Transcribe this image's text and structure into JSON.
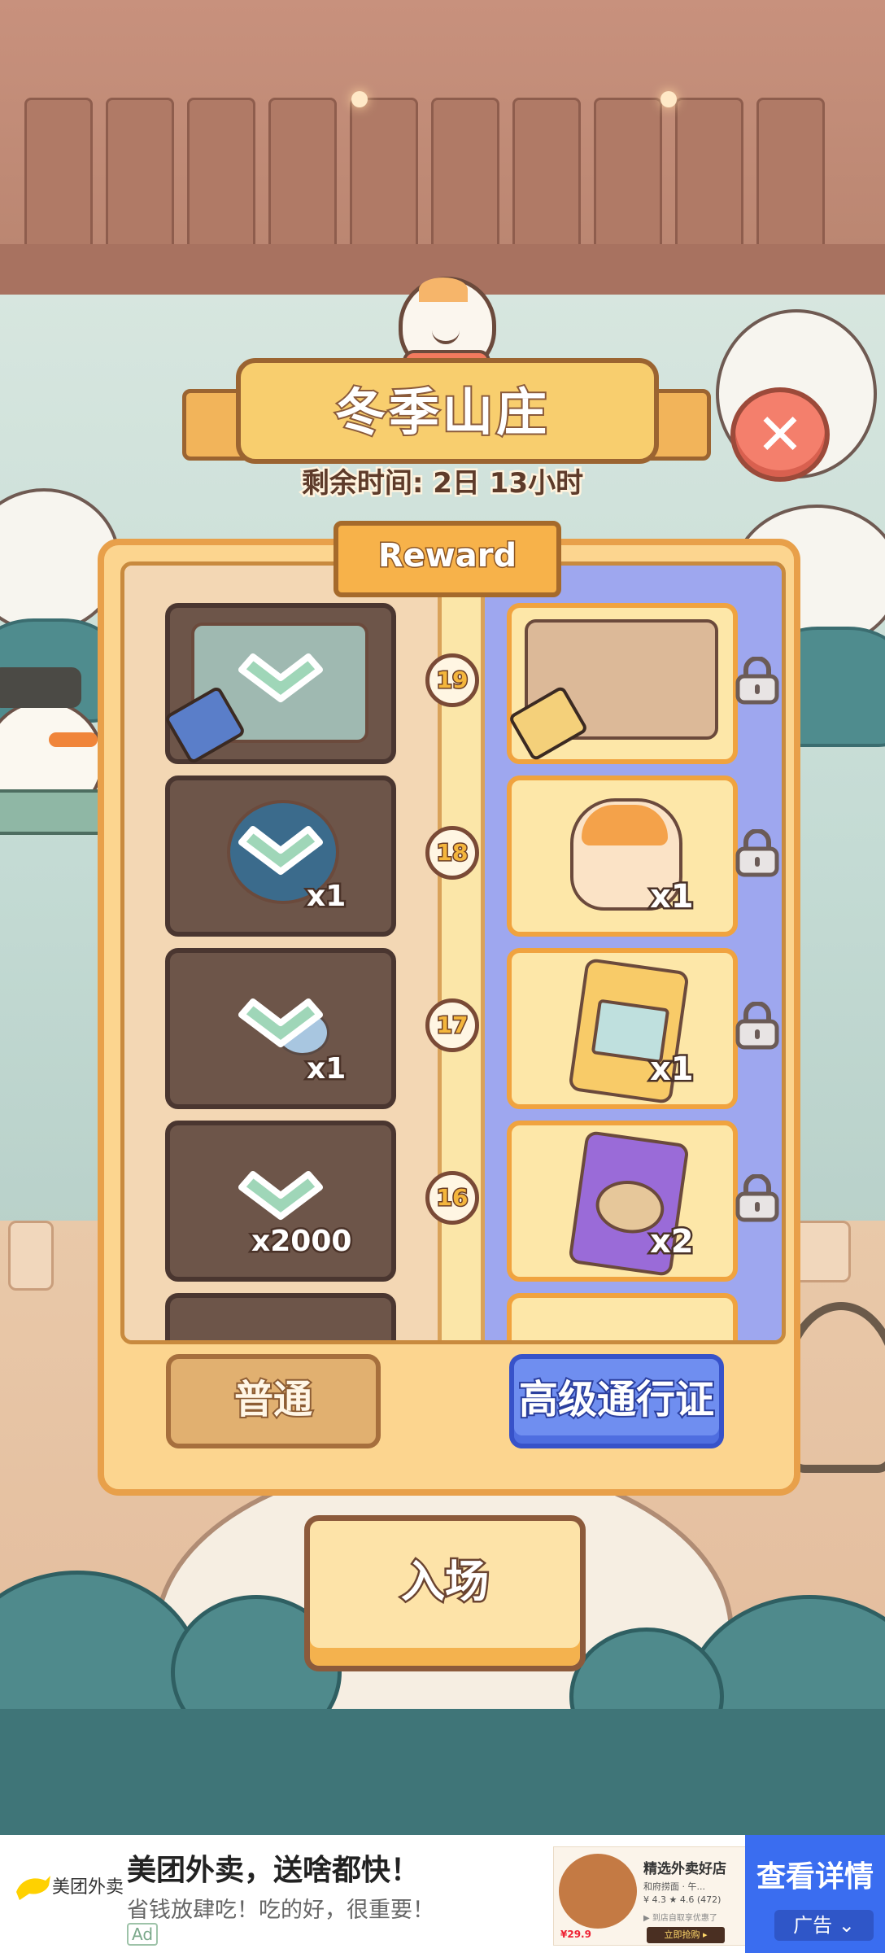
{
  "event": {
    "title": "冬季山庄",
    "timer": "剩余时间: 2日 13小时",
    "reward_tab": "Reward"
  },
  "rows": [
    {
      "level": "19",
      "free_qty": "",
      "premium_qty": "",
      "free_item": "bakery-scene-icon",
      "premium_item": "bakery-shelf-icon",
      "free_claimed": true,
      "premium_locked": true
    },
    {
      "level": "18",
      "free_qty": "x1",
      "premium_qty": "x1",
      "free_item": "yarn-basket-icon",
      "premium_item": "cat-cake-icon",
      "free_claimed": true,
      "premium_locked": true
    },
    {
      "level": "17",
      "free_qty": "x1",
      "premium_qty": "x1",
      "free_item": "flower-icon",
      "premium_item": "painting-card-icon",
      "free_claimed": true,
      "premium_locked": true
    },
    {
      "level": "16",
      "free_qty": "x2000",
      "premium_qty": "x2",
      "free_item": "coin-icon",
      "premium_item": "table-card-icon",
      "free_claimed": true,
      "premium_locked": true
    }
  ],
  "buttons": {
    "normal": "普通",
    "premium": "高级通行证",
    "enter": "入场"
  },
  "ad": {
    "brand": "美团外卖",
    "headline": "美团外卖，送啥都快！",
    "subline": "省钱放肆吃！吃的好，很重要！",
    "tag": "Ad",
    "card_title": "精选外卖好店",
    "card_line1": "和府捞面 · 午...",
    "card_line2": "¥ 4.3  ★ 4.6 (472)",
    "card_line3": "▶ 到店自取享优惠了",
    "card_button": "立即抢购 ▸",
    "card_price": "¥29.9",
    "cta": "查看详情",
    "label": "广告"
  },
  "colors": {
    "panel": "#fcd58f",
    "premium_column": "#9ea7ef",
    "premium_button": "#6f8ef0",
    "close_button": "#f47f6c",
    "ad_cta": "#3a6df0"
  }
}
